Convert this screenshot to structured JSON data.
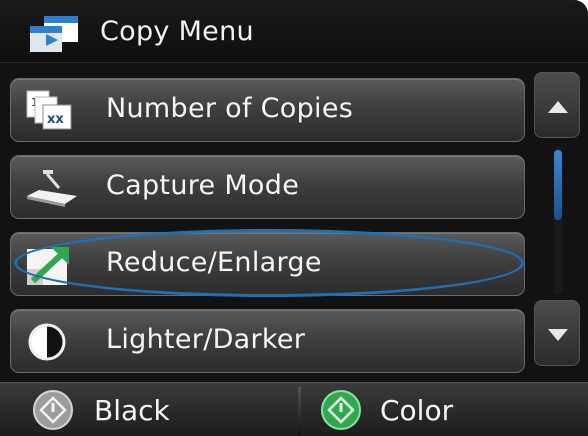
{
  "header": {
    "title": "Copy Menu",
    "icon": "copy-menu-icon"
  },
  "menu": {
    "items": [
      {
        "label": "Number of Copies",
        "icon": "number-of-copies-icon"
      },
      {
        "label": "Capture Mode",
        "icon": "capture-mode-icon"
      },
      {
        "label": "Reduce/Enlarge",
        "icon": "reduce-enlarge-icon",
        "highlighted": true
      },
      {
        "label": "Lighter/Darker",
        "icon": "lighter-darker-icon"
      }
    ]
  },
  "scroll": {
    "up_icon": "arrow-up-icon",
    "down_icon": "arrow-down-icon"
  },
  "footer": {
    "black_label": "Black",
    "color_label": "Color",
    "colors": {
      "highlight_ring": "#1e6fb3",
      "start_green": "#2fa84f"
    }
  }
}
